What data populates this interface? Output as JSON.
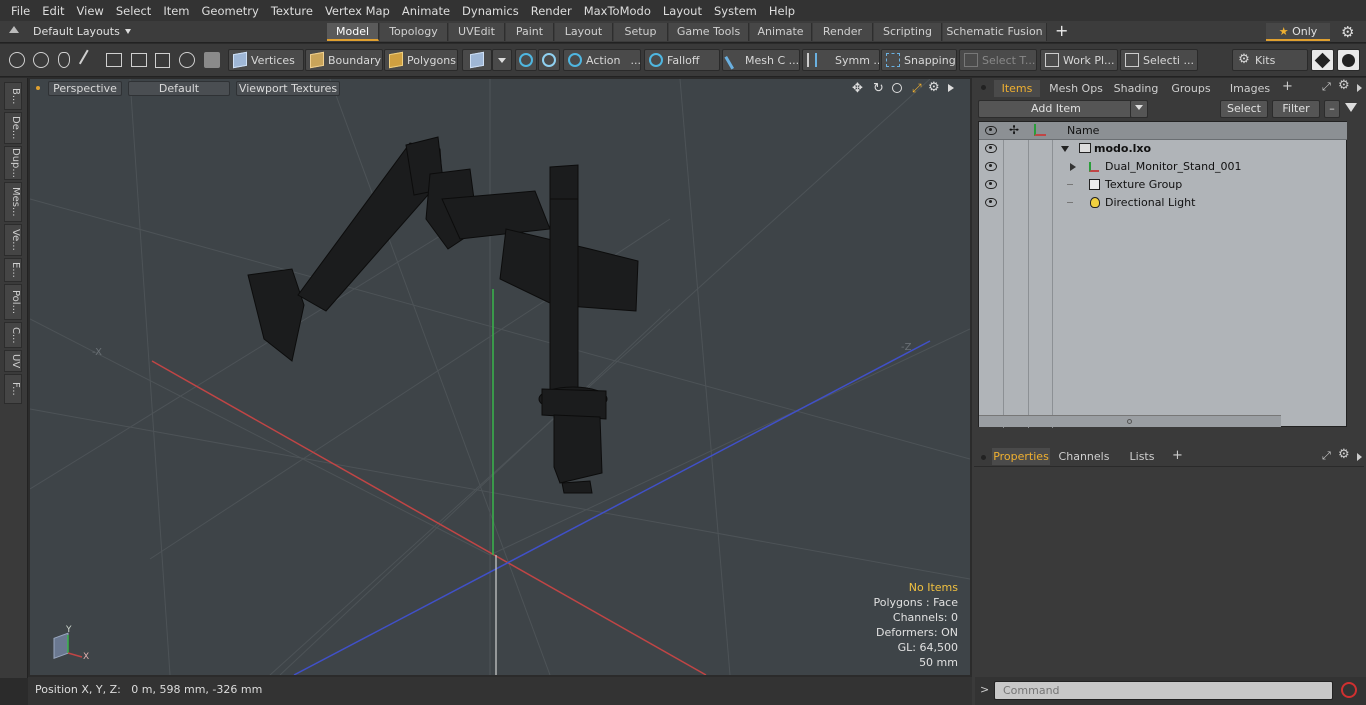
{
  "menu": [
    "File",
    "Edit",
    "View",
    "Select",
    "Item",
    "Geometry",
    "Texture",
    "Vertex Map",
    "Animate",
    "Dynamics",
    "Render",
    "MaxToModo",
    "Layout",
    "System",
    "Help"
  ],
  "layout": {
    "dropdown": "Default Layouts",
    "tabs": [
      "Model",
      "Topology",
      "UVEdit",
      "Paint",
      "Layout",
      "Setup",
      "Game Tools",
      "Animate",
      "Render",
      "Scripting",
      "Schematic Fusion"
    ],
    "active_tab": "Model",
    "only_label": "Only"
  },
  "toolbar": {
    "vertices": "Vertices",
    "boundary": "Boundary",
    "polygons": "Polygons",
    "action": "Action",
    "falloff": "Falloff",
    "mesh_c": "Mesh C ...",
    "symm": "Symm ...",
    "snapping": "Snapping",
    "select_t": "Select T...",
    "work_pl": "Work Pl...",
    "selecti": "Selecti ...",
    "kits": "Kits"
  },
  "left_tabs": [
    "B...",
    "De...",
    "Dup...",
    "Mes...",
    "Ve...",
    "E...",
    "Pol...",
    "C...",
    "UV",
    "F..."
  ],
  "viewport": {
    "perspective": "Perspective",
    "default": "Default",
    "textures": "Viewport Textures",
    "axis_neg_x": "-X",
    "axis_neg_z": "-Z",
    "gizmo_y": "Y",
    "gizmo_x": "X",
    "info": {
      "no_items": "No Items",
      "polygons": "Polygons : Face",
      "channels": "Channels: 0",
      "deformers": "Deformers: ON",
      "gl": "GL: 64,500",
      "scale": "50 mm"
    }
  },
  "status": {
    "position": "Position X, Y, Z:   0 m, 598 mm, -326 mm"
  },
  "right": {
    "tabs": [
      "Items",
      "Mesh Ops",
      "Shading",
      "Groups",
      "Images"
    ],
    "active_tab": "Items",
    "add_item": "Add Item",
    "select": "Select",
    "filter": "Filter",
    "col_name": "Name",
    "items": [
      {
        "name": "modo.lxo",
        "indent": 0
      },
      {
        "name": "Dual_Monitor_Stand_001",
        "indent": 1
      },
      {
        "name": "Texture Group",
        "indent": 1
      },
      {
        "name": "Directional Light",
        "indent": 1
      }
    ],
    "lower_tabs": [
      "Properties",
      "Channels",
      "Lists"
    ],
    "lower_active": "Properties",
    "command_placeholder": "Command"
  }
}
